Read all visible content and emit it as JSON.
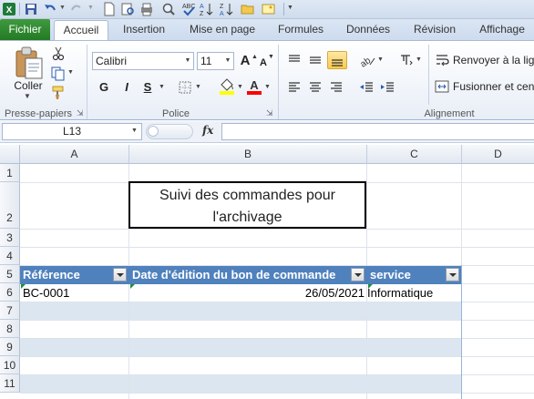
{
  "ribbon_tabs": {
    "file": "Fichier",
    "home": "Accueil",
    "insert": "Insertion",
    "layout": "Mise en page",
    "formulas": "Formules",
    "data": "Données",
    "review": "Révision",
    "view": "Affichage"
  },
  "clipboard": {
    "paste_label": "Coller",
    "group_label": "Presse-papiers"
  },
  "font": {
    "name": "Calibri",
    "size": "11",
    "bold": "G",
    "italic": "I",
    "underline": "S",
    "grow": "A",
    "shrink": "A",
    "fill_color": "#ffff00",
    "font_color": "#ff0000",
    "group_label": "Police"
  },
  "alignment": {
    "wrap_text": "Renvoyer à la ligne",
    "merge_center": "Fusionner et centrer",
    "group_label": "Alignement"
  },
  "formula_bar": {
    "name_box": "L13",
    "fx": "fx",
    "value": ""
  },
  "sheet": {
    "columns": [
      "A",
      "B",
      "C",
      "D"
    ],
    "rows": [
      "1",
      "2",
      "3",
      "4",
      "5",
      "6",
      "7",
      "8",
      "9",
      "10",
      "11"
    ],
    "title_line1": "Suivi des commandes pour",
    "title_line2": "l'archivage",
    "headers": {
      "a": "Référence",
      "b": "Date d'édition du bon de commande",
      "c": "service"
    },
    "row6": {
      "a": "BC-0001",
      "b": "26/05/2021",
      "c": "Informatique"
    }
  },
  "colors": {
    "table_header": "#4f81bd",
    "band": "#dce6f1",
    "file_tab": "#2e8b2e"
  }
}
